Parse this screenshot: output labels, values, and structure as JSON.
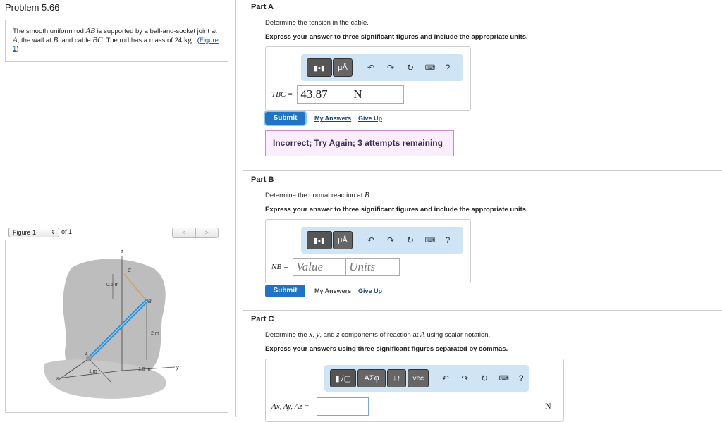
{
  "problem": {
    "title": "Problem 5.66",
    "text_1": "The smooth uniform rod ",
    "rod": "AB",
    "text_2": " is supported by a ball-and-socket joint at ",
    "joint": "A",
    "text_3": ", the wall at ",
    "wall": "B",
    "text_4": ", and cable ",
    "cable": "BC",
    "text_5": ". The rod has a mass of 24 ",
    "mass_unit": "kg",
    "text_6": " . (",
    "figure_link": "Figure 1",
    "text_7": ")"
  },
  "figure": {
    "select_label": "Figure 1",
    "of_label": "of 1",
    "prev": "<",
    "next": ">",
    "labels": {
      "z": "z",
      "c": "C",
      "half_m": "0.5 m",
      "b": "B",
      "two_m": "2 m",
      "a": "A",
      "one_m": "1 m",
      "one_half_m": "1.5 m",
      "x": "x",
      "y": "y"
    }
  },
  "part_a": {
    "title": "Part A",
    "prompt": "Determine the tension in the cable.",
    "instruction": "Express your answer to three significant figures and include the appropriate units.",
    "symbol": "TBC =",
    "value": "43.87",
    "unit": "N",
    "submit": "Submit",
    "my_answers": "My Answers",
    "give_up": "Give Up",
    "feedback": "Incorrect; Try Again; 3 attempts remaining"
  },
  "part_b": {
    "title": "Part B",
    "prompt_1": "Determine the normal reaction at ",
    "prompt_sym": "B",
    "prompt_2": ".",
    "instruction": "Express your answer to three significant figures and include the appropriate units.",
    "symbol": "NB =",
    "value_placeholder": "Value",
    "unit_placeholder": "Units",
    "submit": "Submit",
    "my_answers": "My Answers",
    "give_up": "Give Up"
  },
  "part_c": {
    "title": "Part C",
    "prompt_1": "Determine the ",
    "prompt_x": "x",
    "prompt_2": ", ",
    "prompt_y": "y",
    "prompt_3": ", and ",
    "prompt_z": "z",
    "prompt_4": " components of reaction at ",
    "prompt_a": "A",
    "prompt_5": " using scalar notation.",
    "instruction": "Express your answers using three significant figures separated by commas.",
    "symbol": "Ax, Ay, Az =",
    "unit": "N",
    "vec": "vec",
    "greek": "ΑΣφ"
  },
  "toolbar": {
    "mu": "μÅ",
    "help": "?"
  }
}
